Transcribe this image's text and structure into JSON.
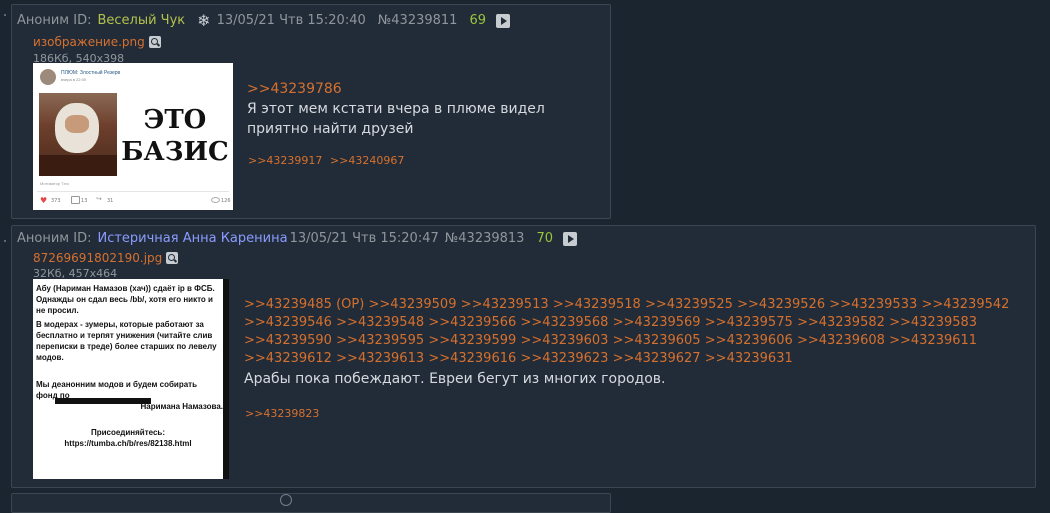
{
  "posts": [
    {
      "anon_label": "Аноним ID:",
      "poster_id": "Веселый Чук",
      "datetime": "13/05/21 Чтв 15:20:40",
      "post_number": "№43239811",
      "replies_count": "69",
      "file": {
        "name": "изображение.png",
        "meta": "186Кб, 540x398",
        "thumb": {
          "header_title": "ПЛЮМ: Злостный Резерв",
          "header_sub": "вчера в 22:00",
          "big_text_1": "ЭТО",
          "big_text_2": "БАЗИС",
          "footer_text": "Мотиватор Тэгз",
          "likes": "373",
          "comments": "13",
          "shares": "31",
          "views": "126"
        }
      },
      "quote_link": ">>43239786",
      "text": "Я этот мем кстати вчера в плюме видел приятно найти друзей",
      "reply_links": [
        ">>43239917",
        ">>43240967"
      ]
    },
    {
      "anon_label": "Аноним ID:",
      "poster_id": "Истеричная Анна Каренина",
      "datetime": "13/05/21 Чтв 15:20:47",
      "post_number": "№43239813",
      "replies_count": "70",
      "file": {
        "name": "87269691802190.jpg",
        "meta": "32Кб, 457x464",
        "thumb": {
          "para1": "Абу (Нариман Намазов (хач)) сдаёт ip в ФСБ. Однажды он сдал весь /bb/, хотя его никто и не просил.",
          "para2": "В модерах - зумеры, которые работают за бесплатно и терпят унижения (читайте слив переписки в треде) более старших по левелу модов.",
          "para3": "Мы деанонним модов и будем собирать фонд по",
          "para3b": "Наримана Намазова.",
          "para4": "Присоединяйтесь:",
          "para5": "https://tumba.ch/b/res/82138.html"
        }
      },
      "quote_links": [
        ">>43239485 (OP)",
        ">>43239509",
        ">>43239513",
        ">>43239518",
        ">>43239525",
        ">>43239526",
        ">>43239533",
        ">>43239542",
        ">>43239546",
        ">>43239548",
        ">>43239566",
        ">>43239568",
        ">>43239569",
        ">>43239575",
        ">>43239582",
        ">>43239583",
        ">>43239590",
        ">>43239595",
        ">>43239599",
        ">>43239603",
        ">>43239605",
        ">>43239606",
        ">>43239608",
        ">>43239611",
        ">>43239612",
        ">>43239613",
        ">>43239616",
        ">>43239623",
        ">>43239627",
        ">>43239631"
      ],
      "text": "Арабы пока побеждают. Евреи бегут из многих городов.",
      "reply_links": [
        ">>43239823"
      ]
    }
  ]
}
